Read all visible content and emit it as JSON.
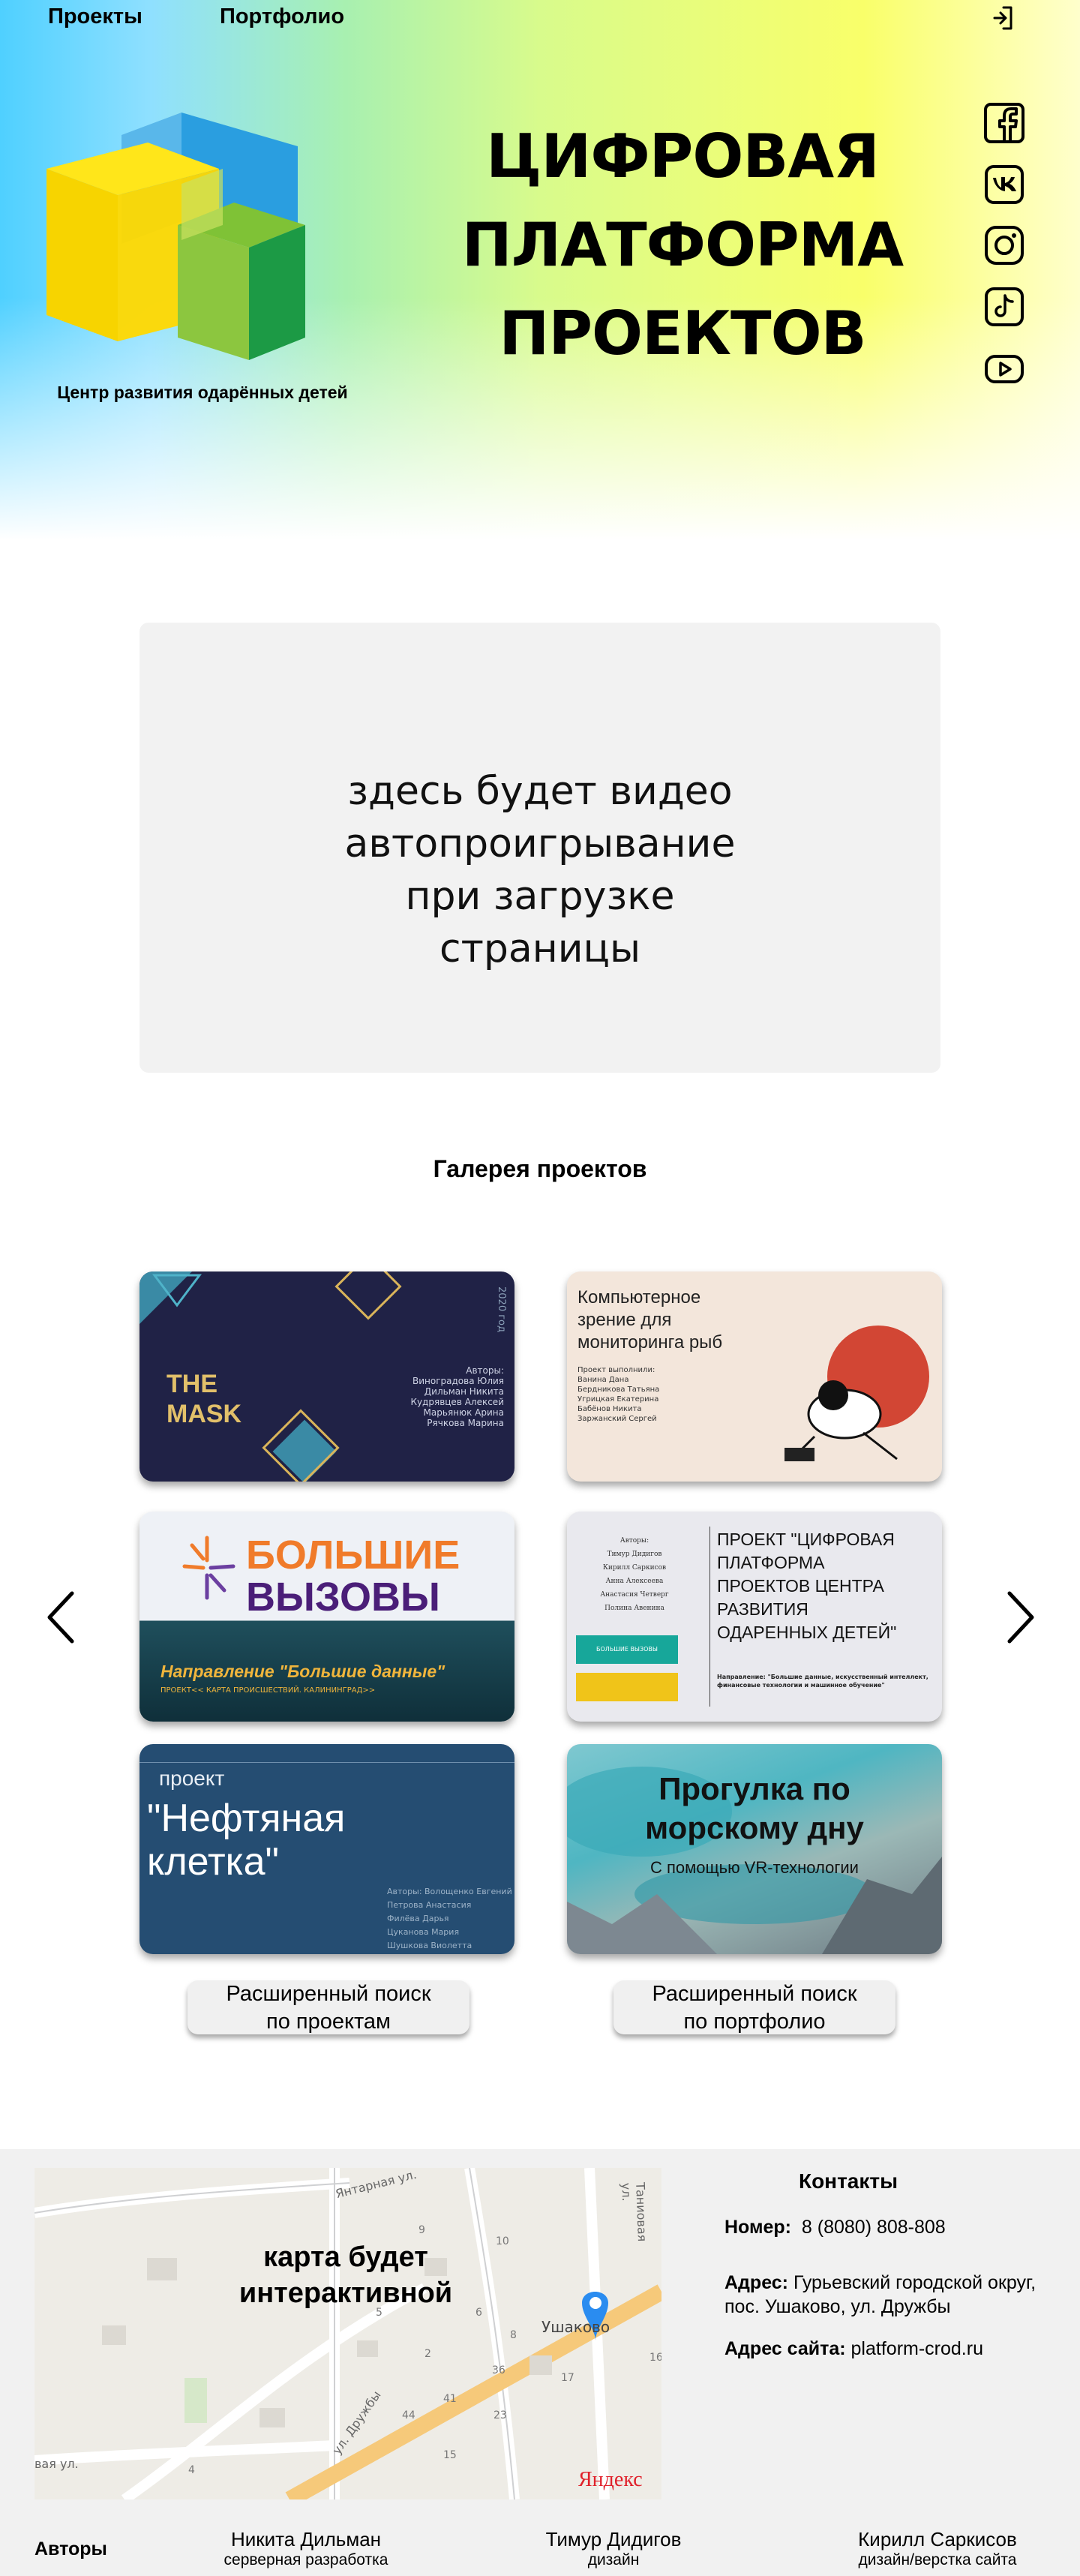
{
  "nav": {
    "projects": "Проекты",
    "portfolio": "Портфолио",
    "login_icon": "login-icon"
  },
  "hero": {
    "logo_caption": "Центр развития одарённых детей",
    "title_lines": [
      "ЦИФРОВАЯ",
      "ПЛАТФОРМА",
      "ПРОЕКТОВ"
    ],
    "social_icons": [
      "facebook-icon",
      "vk-icon",
      "instagram-icon",
      "tiktok-icon",
      "youtube-icon"
    ]
  },
  "video": {
    "lines": [
      "здесь будет видео",
      "автопроигрывание",
      "при загрузке",
      "страницы"
    ]
  },
  "gallery": {
    "title": "Галерея проектов",
    "cards": {
      "mask": {
        "year": "2020 год",
        "title1": "THE",
        "title2": "MASK",
        "authors": [
          "Авторы:",
          "Виноградова Юлия",
          "Дильман Никита",
          "Кудрявцев Алексей",
          "Марьянюк Арина",
          "Рячкова Марина"
        ]
      },
      "fish": {
        "title": [
          "Компьютерное",
          "зрение для",
          "мониторинга рыб"
        ],
        "members": [
          "Проект выполнили:",
          "Ванина Дана",
          "Бердникова Татьяна",
          "Угрицкая Екатерина",
          "Бабёнов Никита",
          "Заржанский Сергей"
        ]
      },
      "vyzovy": {
        "brand1": "БОЛЬШИЕ",
        "brand2": "ВЫЗОВЫ",
        "direction": "Направление \"Большие данные\"",
        "project": "ПРОЕКТ<< КАРТА ПРОИСШЕСТВИЙ. КАЛИНИНГРАД>>"
      },
      "platform": {
        "authors": [
          "Авторы:",
          "Тимур Дидигов",
          "Кирилл Саркисов",
          "Анна Алексеева",
          "Анастасия Четверг",
          "Полина Авенина"
        ],
        "badge1": "БОЛЬШИЕ ВЫЗОВЫ",
        "title": [
          "ПРОЕКТ \"ЦИФРОВАЯ",
          "ПЛАТФОРМА",
          "ПРОЕКТОВ ЦЕНТРА",
          "РАЗВИТИЯ",
          "ОДАРЕННЫХ ДЕТЕЙ\""
        ],
        "direction": [
          "Направление: \"Большие данные, искусственный интеллект,",
          "финансовые технологии и машинное обучение\""
        ]
      },
      "oil": {
        "label": "проект",
        "title": [
          "\"Нефтяная",
          "клетка\""
        ],
        "authors": [
          "Авторы: Волощенко Евгений",
          "Петрова Анастасия",
          "Филёва Дарья",
          "Цуканова Мария",
          "Шушкова Виолетта"
        ]
      },
      "sea": {
        "title": [
          "Прогулка по",
          "морскому дну"
        ],
        "subtitle": "С помощью VR-технологии"
      }
    },
    "search_projects": [
      "Расширенный поиск",
      "по проектам"
    ],
    "search_portfolio": [
      "Расширенный поиск",
      "по портфолио"
    ]
  },
  "map": {
    "overlay": [
      "карта будет",
      "интерактивной"
    ],
    "streets": [
      "Янтарная ул.",
      "Таниовая ул.",
      "ул. Дружбы",
      "вая ул."
    ],
    "place": "Ушаково",
    "house_numbers": [
      "9",
      "10",
      "5",
      "6",
      "8",
      "2",
      "36",
      "17",
      "41",
      "44",
      "23",
      "15",
      "4",
      "16"
    ],
    "provider": "Яндекс"
  },
  "contacts": {
    "title": "Контакты",
    "phone_label": "Номер:",
    "phone": "8 (8080) 808-808",
    "address_label": "Адрес:",
    "address": "Гурьевский городской округ, пос. Ушаково, ул. Дружбы",
    "site_label": "Адрес сайта:",
    "site": "platform-crod.ru"
  },
  "authors": {
    "label": "Авторы",
    "list": [
      {
        "name": "Никита Дильман",
        "role": "серверная разработка"
      },
      {
        "name": "Тимур Дидигов",
        "role": "дизайн"
      },
      {
        "name": "Кирилл Саркисов",
        "role": "дизайн/верстка сайта"
      }
    ]
  }
}
